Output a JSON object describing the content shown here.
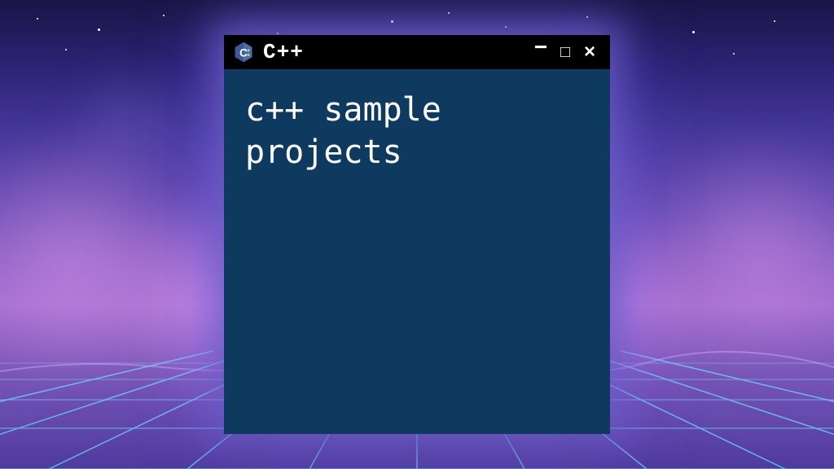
{
  "window": {
    "title": "C++",
    "icon_name": "cpp-logo-icon",
    "controls": {
      "minimize": "−",
      "maximize": "□",
      "close": "×"
    },
    "body_text": "c++ sample projects"
  },
  "colors": {
    "titlebar_bg": "#000000",
    "window_body_bg": "#0e3a5f",
    "text": "#ffffff",
    "cpp_icon_fill": "#4a6fa5",
    "cpp_icon_text": "#ffffff"
  }
}
